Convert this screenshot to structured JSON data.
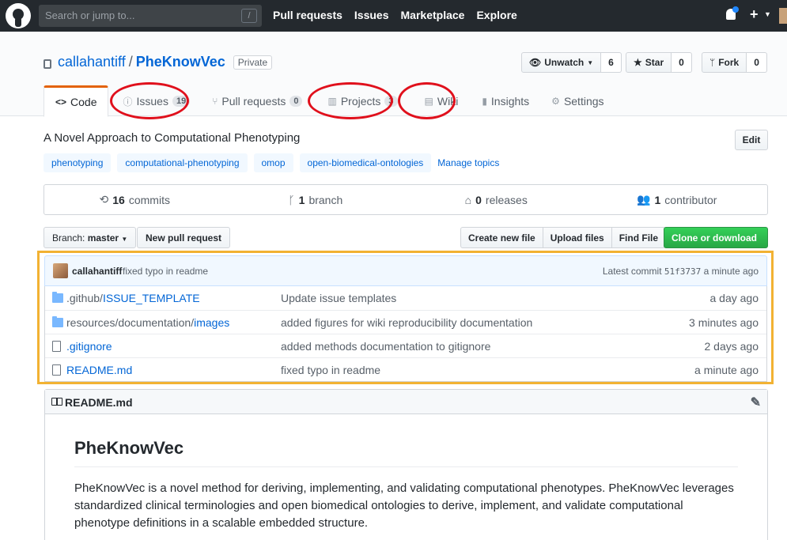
{
  "topbar": {
    "search_placeholder": "Search or jump to...",
    "search_shortcut": "/",
    "nav": [
      "Pull requests",
      "Issues",
      "Marketplace",
      "Explore"
    ]
  },
  "repo": {
    "owner": "callahantiff",
    "separator": "/",
    "name": "PheKnowVec",
    "visibility": "Private",
    "watch": {
      "label": "Unwatch",
      "count": "6"
    },
    "star": {
      "label": "Star",
      "count": "0"
    },
    "fork": {
      "label": "Fork",
      "count": "0"
    }
  },
  "tabs": [
    {
      "label": "Code",
      "icon": "code-icon"
    },
    {
      "label": "Issues",
      "count": "19",
      "icon": "issue-icon"
    },
    {
      "label": "Pull requests",
      "count": "0",
      "icon": "pull-request-icon"
    },
    {
      "label": "Projects",
      "count": "3",
      "icon": "project-icon"
    },
    {
      "label": "Wiki",
      "icon": "book-icon"
    },
    {
      "label": "Insights",
      "icon": "graph-icon"
    },
    {
      "label": "Settings",
      "icon": "gear-icon"
    }
  ],
  "description": "A Novel Approach to Computational Phenotyping",
  "edit_label": "Edit",
  "topics": [
    "phenotyping",
    "computational-phenotyping",
    "omop",
    "open-biomedical-ontologies"
  ],
  "manage_topics": "Manage topics",
  "summary": {
    "commits": {
      "num": "16",
      "label": "commits"
    },
    "branches": {
      "num": "1",
      "label": "branch"
    },
    "releases": {
      "num": "0",
      "label": "releases"
    },
    "contributors": {
      "num": "1",
      "label": "contributor"
    }
  },
  "filenav": {
    "branch_prefix": "Branch:",
    "branch_name": "master",
    "new_pr": "New pull request",
    "create_file": "Create new file",
    "upload": "Upload files",
    "find": "Find File",
    "clone": "Clone or download"
  },
  "latest_commit": {
    "author": "callahantiff",
    "message": "fixed typo in readme",
    "prefix": "Latest commit",
    "sha": "51f3737",
    "age": "a minute ago"
  },
  "files": [
    {
      "type": "dir",
      "prefix": ".github/",
      "name": "ISSUE_TEMPLATE",
      "message": "Update issue templates",
      "age": "a day ago"
    },
    {
      "type": "dir",
      "prefix": "resources/documentation/",
      "name": "images",
      "message": "added figures for wiki reproducibility documentation",
      "age": "3 minutes ago"
    },
    {
      "type": "file",
      "prefix": "",
      "name": ".gitignore",
      "message": "added methods documentation to gitignore",
      "age": "2 days ago"
    },
    {
      "type": "file",
      "prefix": "",
      "name": "README.md",
      "message": "fixed typo in readme",
      "age": "a minute ago"
    }
  ],
  "readme": {
    "filename": "README.md",
    "heading": "PheKnowVec",
    "body": "PheKnowVec is a novel method for deriving, implementing, and validating computational phenotypes. PheKnowVec leverages standardized clinical terminologies and open biomedical ontologies to derive, implement, and validate computational phenotype definitions in a scalable embedded structure."
  },
  "colors": {
    "annotation_circle": "#e0101c",
    "annotation_box": "#f2b233",
    "clone_button": "#28a745",
    "link": "#0366d6"
  }
}
